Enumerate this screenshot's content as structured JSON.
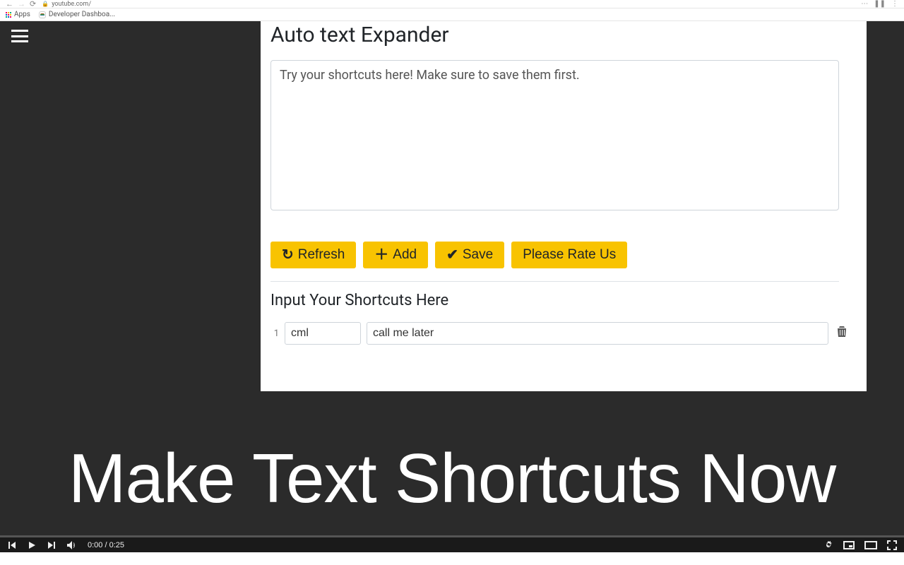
{
  "browser": {
    "url_host": "youtube.com/",
    "bookmarks": {
      "apps": "Apps",
      "dev": "Developer Dashboa..."
    }
  },
  "popup": {
    "title": "Auto text Expander",
    "try_placeholder": "Try your shortcuts here! Make sure to save them first.",
    "buttons": {
      "refresh": "Refresh",
      "add": "Add",
      "save": "Save",
      "rate": "Please Rate Us"
    },
    "section_title": "Input Your Shortcuts Here",
    "row": {
      "num": "1",
      "key": "cml",
      "val": "call me later"
    }
  },
  "overlay_text": "Make Text Shortcuts Now",
  "player": {
    "prev": "prev",
    "time": "0:00 / 0:25"
  }
}
